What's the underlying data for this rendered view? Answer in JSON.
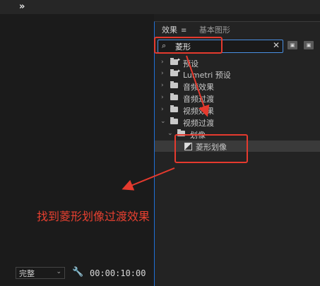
{
  "topbar": {
    "expand_icon": "double-chevron-right-icon",
    "expand_glyph": "»"
  },
  "effects_panel": {
    "tabs": [
      {
        "label": "效果",
        "menu_glyph": "≡"
      },
      {
        "label": "基本图形"
      }
    ],
    "search": {
      "value": "菱形",
      "clear_glyph": "✕"
    },
    "tree": [
      {
        "label": "预设",
        "expanded": false,
        "icon": "folder-star-icon"
      },
      {
        "label": "Lumetri 预设",
        "expanded": false,
        "icon": "folder-star-icon"
      },
      {
        "label": "音频效果",
        "expanded": false,
        "icon": "folder-icon"
      },
      {
        "label": "音频过渡",
        "expanded": false,
        "icon": "folder-icon"
      },
      {
        "label": "视频效果",
        "expanded": false,
        "icon": "folder-icon"
      },
      {
        "label": "视频过渡",
        "expanded": true,
        "icon": "folder-icon"
      },
      {
        "label": "划像",
        "expanded": true,
        "icon": "folder-icon"
      },
      {
        "label": "菱形划像",
        "icon": "transition-effect-icon",
        "selected": true
      }
    ]
  },
  "bottombar": {
    "quality_select": "完整",
    "timecode": "00:00:10:00"
  },
  "annotation": {
    "text": "找到菱形划像过渡效果",
    "color": "#e53a2e"
  },
  "colors": {
    "accent": "#1f6fd6",
    "annotation": "#e53a2e"
  }
}
